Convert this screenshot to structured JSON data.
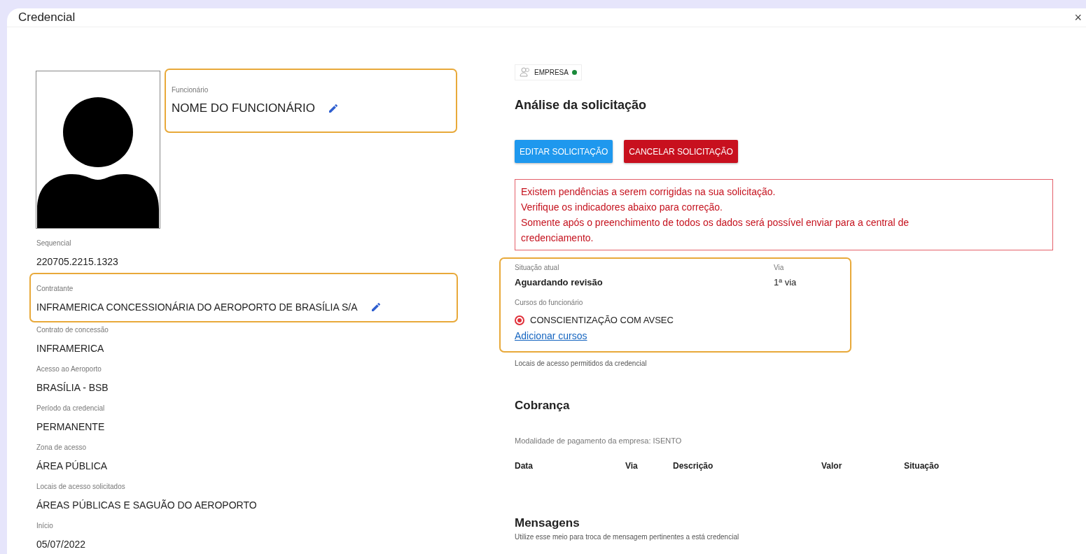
{
  "dialog": {
    "title": "Credencial",
    "close": "×"
  },
  "employee": {
    "label": "Funcionário",
    "value": "NOME DO FUNCIONÁRIO",
    "editable": true,
    "highlighted": true
  },
  "fields": [
    {
      "label": "Sequencial",
      "value": "220705.2215.1323",
      "editable": false,
      "highlighted": false
    },
    {
      "label": "Contratante",
      "value": "INFRAMERICA CONCESSIONÁRIA DO AEROPORTO DE BRASÍLIA S/A",
      "editable": true,
      "highlighted": true
    },
    {
      "label": "Contrato de concessão",
      "value": "INFRAMERICA",
      "editable": false,
      "highlighted": false
    },
    {
      "label": "Acesso ao Aeroporto",
      "value": "BRASÍLIA - BSB",
      "editable": false,
      "highlighted": false
    },
    {
      "label": "Período da credencial",
      "value": "PERMANENTE",
      "editable": false,
      "highlighted": false
    },
    {
      "label": "Zona de acesso",
      "value": "ÁREA PÚBLICA",
      "editable": false,
      "highlighted": false
    },
    {
      "label": "Locais de acesso solicitados",
      "value": "ÁREAS PÚBLICAS E SAGUÃO DO AEROPORTO",
      "editable": false,
      "highlighted": false
    },
    {
      "label": "Início",
      "value": "05/07/2022",
      "editable": false,
      "highlighted": false
    }
  ],
  "profile_badge": {
    "label": "EMPRESA",
    "online": true
  },
  "analysis": {
    "title": "Análise da solicitação",
    "buttons": [
      {
        "label": "EDITAR SOLICITAÇÃO",
        "kind": "primary"
      },
      {
        "label": "CANCELAR SOLICITAÇÃO",
        "kind": "danger"
      }
    ],
    "alert_lines": [
      "Existem pendências a serem corrigidas na sua solicitação.",
      "Verifique os indicadores abaixo para correção.",
      "Somente após o preenchimento de todos os dados será possível enviar para a central de credenciamento."
    ],
    "status": {
      "highlighted": true,
      "situation_label": "Situação atual",
      "situation": "Aguardando revisão",
      "via_label": "Via",
      "via": "1ª via",
      "courses_label": "Cursos do funcionário",
      "courses": [
        {
          "name": "CONSCIENTIZAÇÃO COM AVSEC",
          "color": "#e0303a"
        }
      ],
      "add_link": "Adicionar cursos"
    },
    "access_note": "Locais de acesso permitidos da credencial"
  },
  "billing": {
    "title": "Cobrança",
    "payment_mode": "Modalidade de pagamento da empresa: ISENTO",
    "columns": [
      "Data",
      "Via",
      "Descrição",
      "Valor",
      "Situação"
    ]
  },
  "messages": {
    "title": "Mensagens",
    "subtitle": "Utilize esse meio para troca de mensagem pertinentes a está credencial"
  }
}
